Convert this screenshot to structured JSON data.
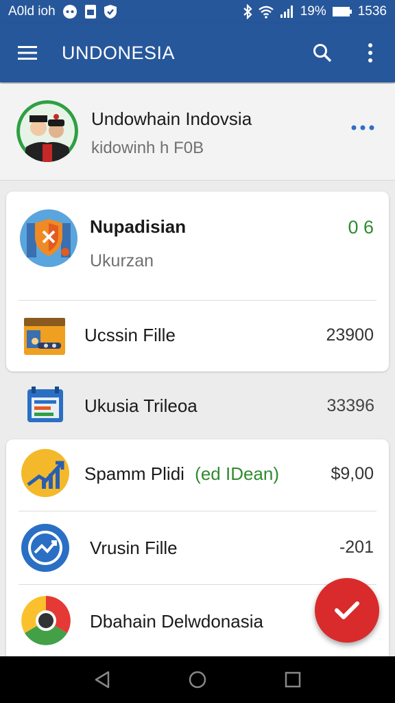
{
  "status_bar": {
    "carrier": "A0ld ioh",
    "battery_pct": "19%",
    "time": "1536"
  },
  "app_bar": {
    "title": "UNDONESIA",
    "icons": [
      "menu-icon",
      "search-icon",
      "more-vert-icon"
    ]
  },
  "profile": {
    "name": "Undowhain Indovsia",
    "subtitle": "kidowinh h F0B"
  },
  "card1": {
    "header_title": "Nupadisian",
    "header_sub": "Ukurzan",
    "header_value": "0 6",
    "header_value_color": "#2e8b2e",
    "row_label": "Ucssin Fille",
    "row_value": "23900"
  },
  "plain_row": {
    "label": "Ukusia Trileoa",
    "value": "33396"
  },
  "card2": {
    "rows": [
      {
        "label": "Spamm Plidi",
        "label_extra": "(ed IDean)",
        "value": "$9,00"
      },
      {
        "label": "Vrusin Fille",
        "value": "-201"
      },
      {
        "label": "Dbahain Delwdonasia",
        "value": ""
      }
    ]
  },
  "colors": {
    "primary": "#27579b",
    "fab": "#d92b2b",
    "accent_dots": "#2f6fc4"
  }
}
